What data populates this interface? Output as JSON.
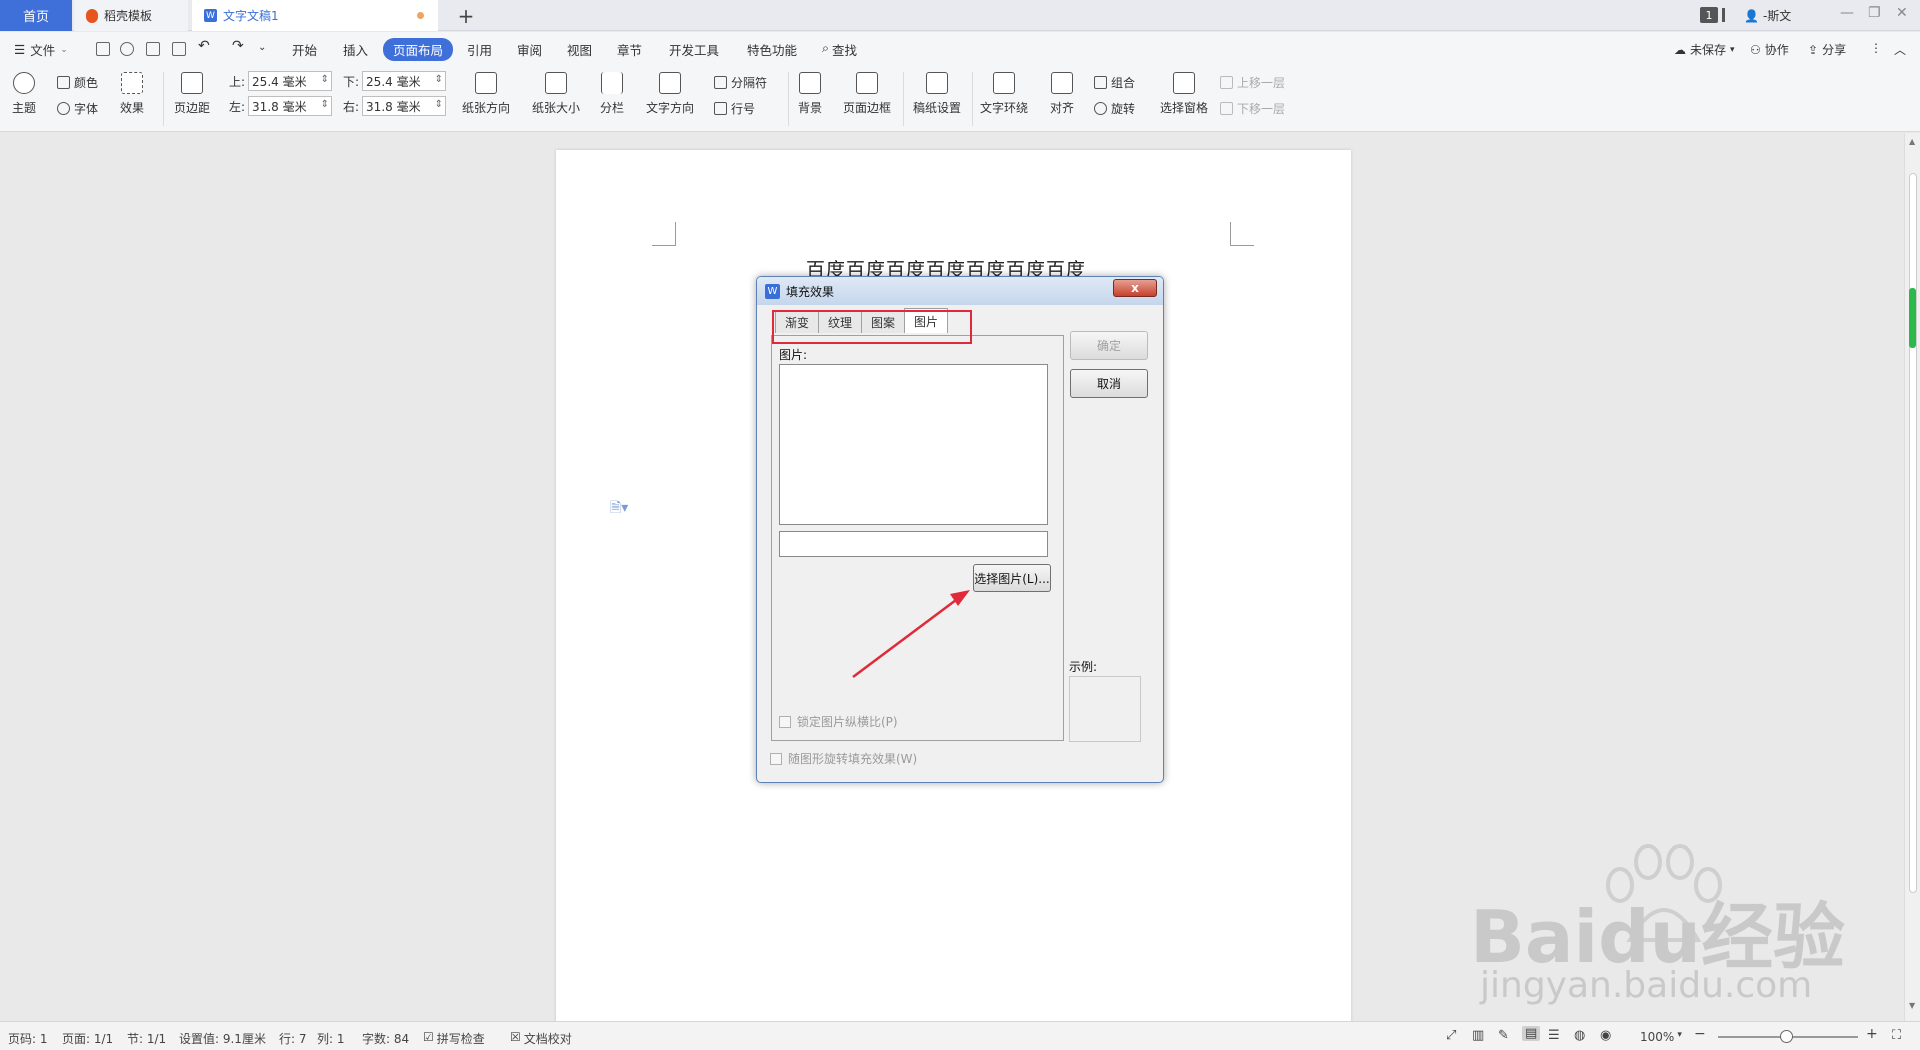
{
  "tabs": {
    "home": "首页",
    "template": "稻壳模板",
    "document": "文字文稿1",
    "new_tab": "+"
  },
  "titlebar": {
    "badge": "1",
    "user": "-斯文"
  },
  "menu": {
    "file": "文件",
    "items": [
      "开始",
      "插入",
      "页面布局",
      "引用",
      "审阅",
      "视图",
      "章节",
      "开发工具",
      "特色功能"
    ],
    "active": "页面布局",
    "search": "查找",
    "unsaved": "未保存",
    "collab": "协作",
    "share": "分享"
  },
  "ribbon": {
    "theme": "主题",
    "color": "颜色",
    "font": "字体",
    "effect": "效果",
    "margins": "页边距",
    "margin_top_label": "上:",
    "margin_top": "25.4 毫米",
    "margin_bottom_label": "下:",
    "margin_bottom": "25.4 毫米",
    "margin_left_label": "左:",
    "margin_left": "31.8 毫米",
    "margin_right_label": "右:",
    "margin_right": "31.8 毫米",
    "orientation": "纸张方向",
    "size": "纸张大小",
    "columns": "分栏",
    "text_direction": "文字方向",
    "separator": "分隔符",
    "line_numbers": "行号",
    "background": "背景",
    "page_border": "页面边框",
    "grid_paper": "稿纸设置",
    "text_wrap": "文字环绕",
    "align": "对齐",
    "group": "组合",
    "rotate": "旋转",
    "selection_pane": "选择窗格",
    "bring_forward": "上移一层",
    "send_backward": "下移一层"
  },
  "document": {
    "text": "百度百度百度百度百度百度百度"
  },
  "dialog": {
    "title": "填充效果",
    "close": "x",
    "tabs": [
      "渐变",
      "纹理",
      "图案",
      "图片"
    ],
    "active_tab": "图片",
    "picture_label": "图片:",
    "select_picture": "选择图片(L)...",
    "lock_aspect": "锁定图片纵横比(P)",
    "rotate_with_shape": "随图形旋转填充效果(W)",
    "ok": "确定",
    "cancel": "取消",
    "sample_label": "示例:",
    "picture_path": ""
  },
  "status": {
    "page": "页码: 1",
    "pages": "页面: 1/1",
    "section": "节: 1/1",
    "setting": "设置值: 9.1厘米",
    "row": "行: 7",
    "col": "列: 1",
    "words": "字数: 84",
    "spell": "拼写检查",
    "proof": "文档校对",
    "zoom": "100%"
  },
  "watermark": {
    "brand": "Baidu经验",
    "url": "jingyan.baidu.com"
  },
  "colors": {
    "accent": "#3f6fd8",
    "highlight": "#e0293a",
    "arrow": "#e0293a",
    "scroll_indicator": "#2db84c"
  }
}
